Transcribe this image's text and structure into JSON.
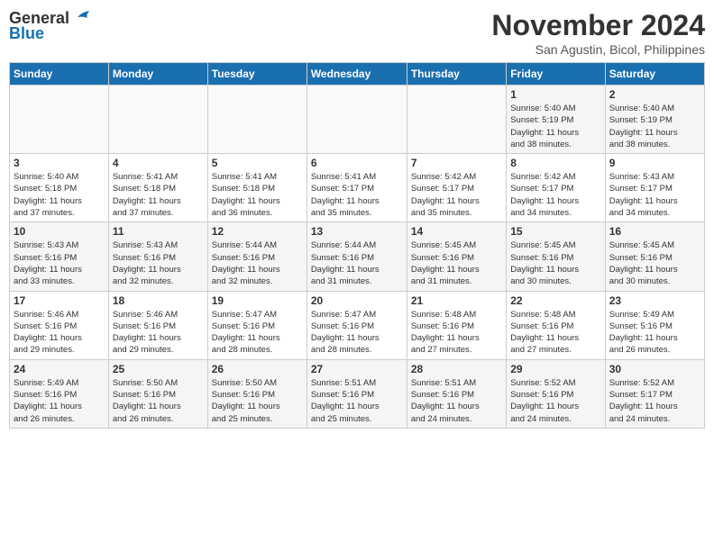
{
  "header": {
    "logo_line1": "General",
    "logo_line2": "Blue",
    "month": "November 2024",
    "location": "San Agustin, Bicol, Philippines"
  },
  "weekdays": [
    "Sunday",
    "Monday",
    "Tuesday",
    "Wednesday",
    "Thursday",
    "Friday",
    "Saturday"
  ],
  "weeks": [
    [
      {
        "day": "",
        "info": ""
      },
      {
        "day": "",
        "info": ""
      },
      {
        "day": "",
        "info": ""
      },
      {
        "day": "",
        "info": ""
      },
      {
        "day": "",
        "info": ""
      },
      {
        "day": "1",
        "info": "Sunrise: 5:40 AM\nSunset: 5:19 PM\nDaylight: 11 hours\nand 38 minutes."
      },
      {
        "day": "2",
        "info": "Sunrise: 5:40 AM\nSunset: 5:19 PM\nDaylight: 11 hours\nand 38 minutes."
      }
    ],
    [
      {
        "day": "3",
        "info": "Sunrise: 5:40 AM\nSunset: 5:18 PM\nDaylight: 11 hours\nand 37 minutes."
      },
      {
        "day": "4",
        "info": "Sunrise: 5:41 AM\nSunset: 5:18 PM\nDaylight: 11 hours\nand 37 minutes."
      },
      {
        "day": "5",
        "info": "Sunrise: 5:41 AM\nSunset: 5:18 PM\nDaylight: 11 hours\nand 36 minutes."
      },
      {
        "day": "6",
        "info": "Sunrise: 5:41 AM\nSunset: 5:17 PM\nDaylight: 11 hours\nand 35 minutes."
      },
      {
        "day": "7",
        "info": "Sunrise: 5:42 AM\nSunset: 5:17 PM\nDaylight: 11 hours\nand 35 minutes."
      },
      {
        "day": "8",
        "info": "Sunrise: 5:42 AM\nSunset: 5:17 PM\nDaylight: 11 hours\nand 34 minutes."
      },
      {
        "day": "9",
        "info": "Sunrise: 5:43 AM\nSunset: 5:17 PM\nDaylight: 11 hours\nand 34 minutes."
      }
    ],
    [
      {
        "day": "10",
        "info": "Sunrise: 5:43 AM\nSunset: 5:16 PM\nDaylight: 11 hours\nand 33 minutes."
      },
      {
        "day": "11",
        "info": "Sunrise: 5:43 AM\nSunset: 5:16 PM\nDaylight: 11 hours\nand 32 minutes."
      },
      {
        "day": "12",
        "info": "Sunrise: 5:44 AM\nSunset: 5:16 PM\nDaylight: 11 hours\nand 32 minutes."
      },
      {
        "day": "13",
        "info": "Sunrise: 5:44 AM\nSunset: 5:16 PM\nDaylight: 11 hours\nand 31 minutes."
      },
      {
        "day": "14",
        "info": "Sunrise: 5:45 AM\nSunset: 5:16 PM\nDaylight: 11 hours\nand 31 minutes."
      },
      {
        "day": "15",
        "info": "Sunrise: 5:45 AM\nSunset: 5:16 PM\nDaylight: 11 hours\nand 30 minutes."
      },
      {
        "day": "16",
        "info": "Sunrise: 5:45 AM\nSunset: 5:16 PM\nDaylight: 11 hours\nand 30 minutes."
      }
    ],
    [
      {
        "day": "17",
        "info": "Sunrise: 5:46 AM\nSunset: 5:16 PM\nDaylight: 11 hours\nand 29 minutes."
      },
      {
        "day": "18",
        "info": "Sunrise: 5:46 AM\nSunset: 5:16 PM\nDaylight: 11 hours\nand 29 minutes."
      },
      {
        "day": "19",
        "info": "Sunrise: 5:47 AM\nSunset: 5:16 PM\nDaylight: 11 hours\nand 28 minutes."
      },
      {
        "day": "20",
        "info": "Sunrise: 5:47 AM\nSunset: 5:16 PM\nDaylight: 11 hours\nand 28 minutes."
      },
      {
        "day": "21",
        "info": "Sunrise: 5:48 AM\nSunset: 5:16 PM\nDaylight: 11 hours\nand 27 minutes."
      },
      {
        "day": "22",
        "info": "Sunrise: 5:48 AM\nSunset: 5:16 PM\nDaylight: 11 hours\nand 27 minutes."
      },
      {
        "day": "23",
        "info": "Sunrise: 5:49 AM\nSunset: 5:16 PM\nDaylight: 11 hours\nand 26 minutes."
      }
    ],
    [
      {
        "day": "24",
        "info": "Sunrise: 5:49 AM\nSunset: 5:16 PM\nDaylight: 11 hours\nand 26 minutes."
      },
      {
        "day": "25",
        "info": "Sunrise: 5:50 AM\nSunset: 5:16 PM\nDaylight: 11 hours\nand 26 minutes."
      },
      {
        "day": "26",
        "info": "Sunrise: 5:50 AM\nSunset: 5:16 PM\nDaylight: 11 hours\nand 25 minutes."
      },
      {
        "day": "27",
        "info": "Sunrise: 5:51 AM\nSunset: 5:16 PM\nDaylight: 11 hours\nand 25 minutes."
      },
      {
        "day": "28",
        "info": "Sunrise: 5:51 AM\nSunset: 5:16 PM\nDaylight: 11 hours\nand 24 minutes."
      },
      {
        "day": "29",
        "info": "Sunrise: 5:52 AM\nSunset: 5:16 PM\nDaylight: 11 hours\nand 24 minutes."
      },
      {
        "day": "30",
        "info": "Sunrise: 5:52 AM\nSunset: 5:17 PM\nDaylight: 11 hours\nand 24 minutes."
      }
    ]
  ]
}
